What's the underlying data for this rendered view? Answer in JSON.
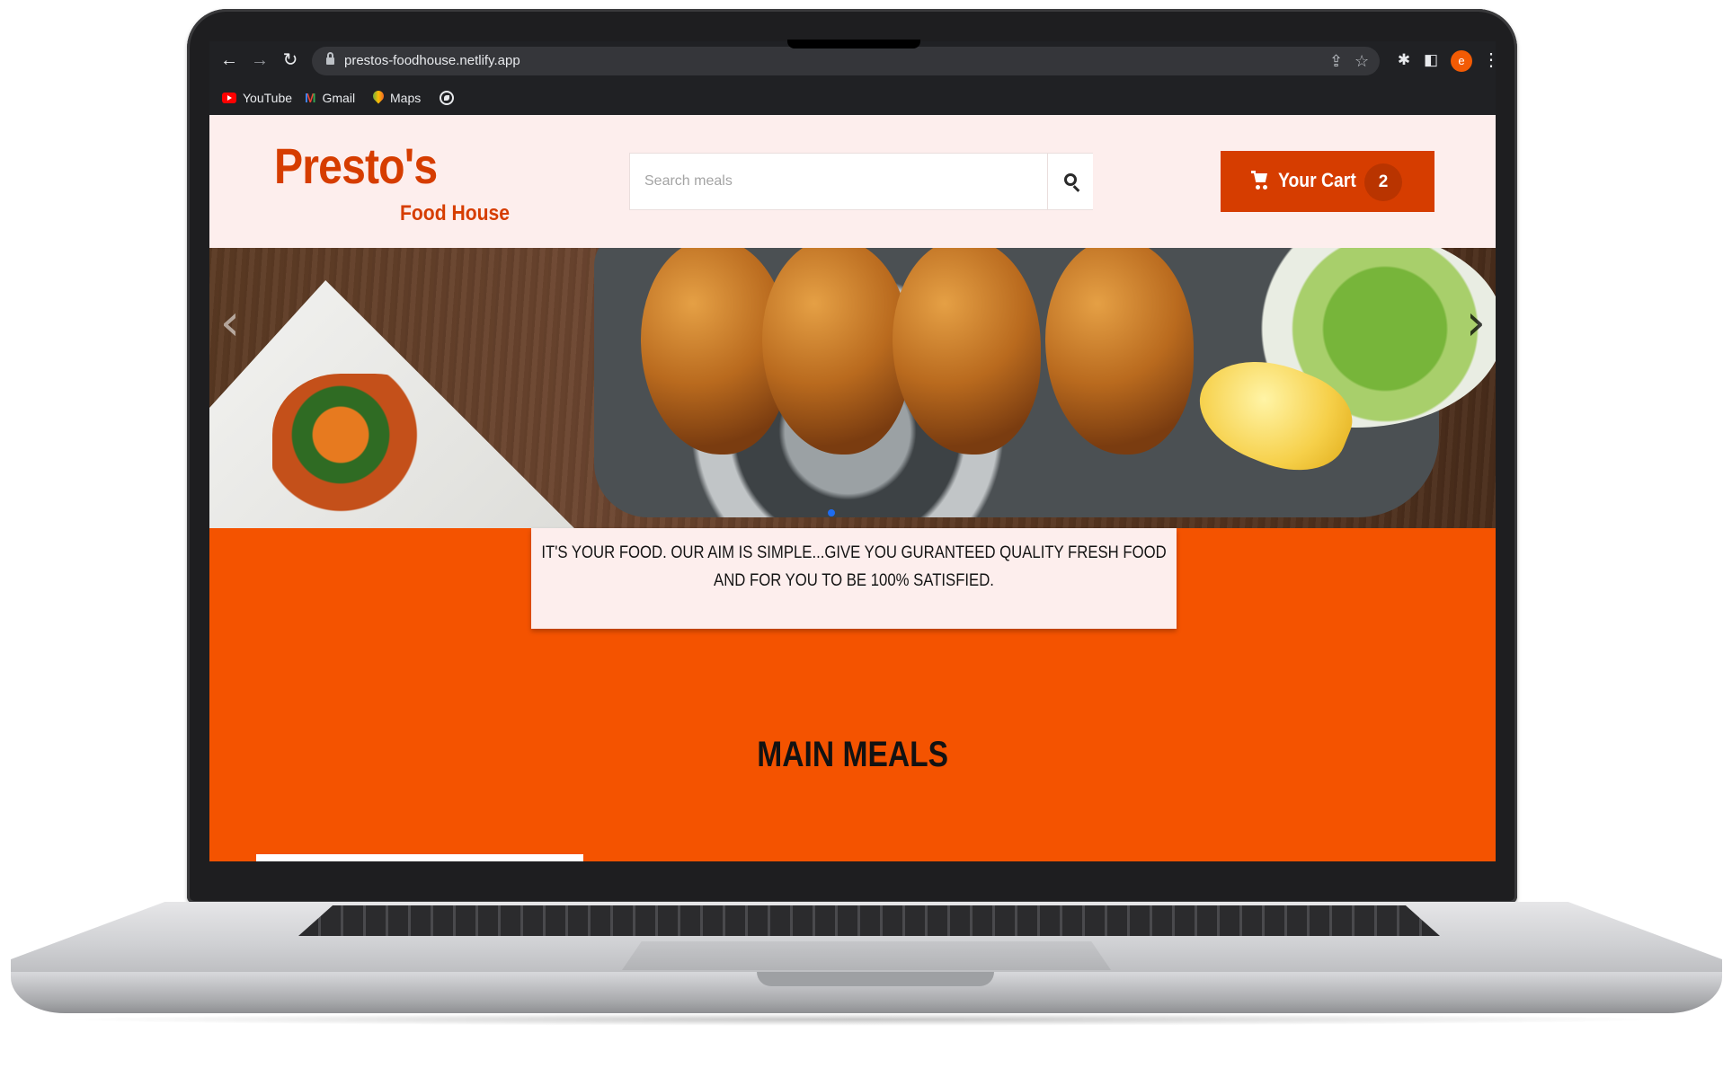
{
  "browser": {
    "url": "prestos-foodhouse.netlify.app",
    "profile_initial": "e",
    "bookmarks": [
      {
        "label": "YouTube",
        "icon": "youtube-icon"
      },
      {
        "label": "Gmail",
        "icon": "gmail-icon"
      },
      {
        "label": "Maps",
        "icon": "maps-icon"
      }
    ]
  },
  "header": {
    "brand_name": "Presto's",
    "brand_sub": "Food House",
    "search_placeholder": "Search meals",
    "cart_label": "Your Cart",
    "cart_count": "2"
  },
  "hero": {
    "tagline": "IT'S YOUR FOOD. OUR AIM IS SIMPLE...GIVE YOU GURANTEED QUALITY FRESH FOOD AND FOR YOU TO BE 100% SATISFIED."
  },
  "main": {
    "section_title": "MAIN MEALS"
  },
  "colors": {
    "brand": "#d63d00",
    "page_background": "#f45300",
    "header_background": "#fdeeed"
  }
}
